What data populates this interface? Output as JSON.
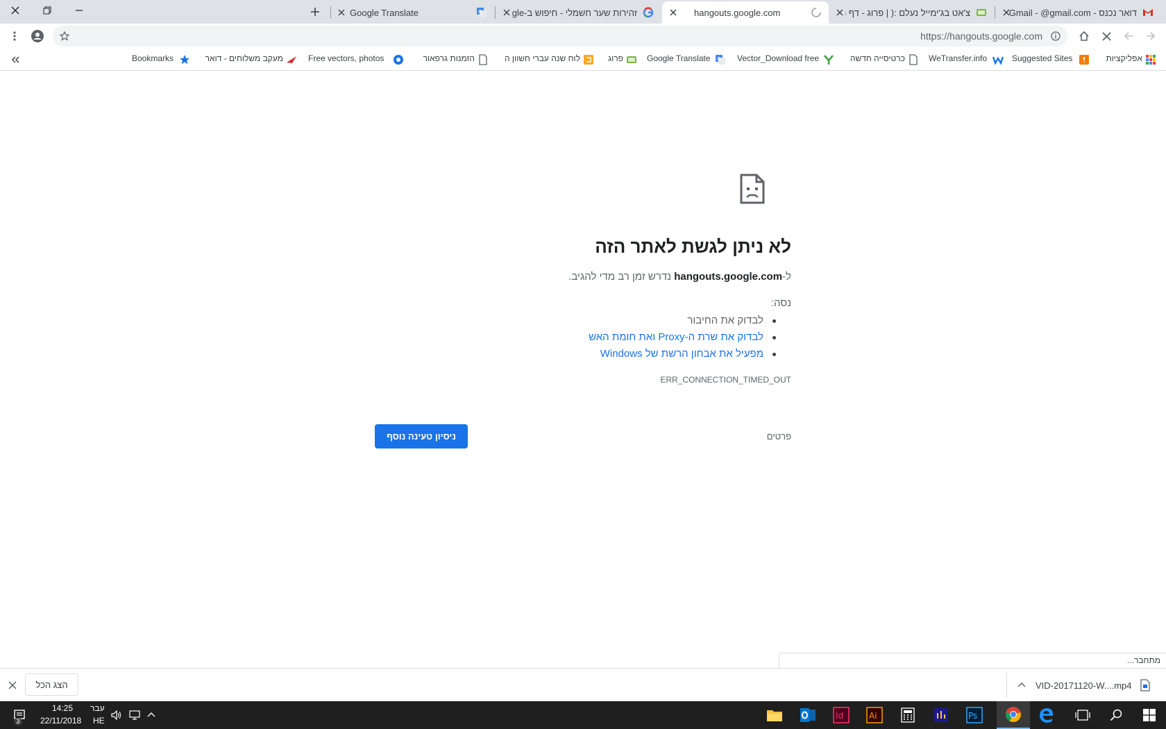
{
  "tabs": [
    {
      "title": "דואר נכנס - Gmail - @gmail.com",
      "active": false
    },
    {
      "title": "צ'אט בג'ימייל נעלם :( | פרוג - דף ה",
      "active": false
    },
    {
      "title": "hangouts.google.com",
      "active": true
    },
    {
      "title": "זהירות שער חשמלי - חיפוש ב-Google",
      "active": false
    },
    {
      "title": "Google Translate",
      "active": false
    }
  ],
  "toolbar": {
    "url": "https://hangouts.google.com"
  },
  "bookmarks": [
    {
      "label": "אפליקציות",
      "icon": "apps-grid-icon"
    },
    {
      "label": "Suggested Sites",
      "icon": "suggested-sites-icon"
    },
    {
      "label": "WeTransfer.info",
      "icon": "wetransfer-icon"
    },
    {
      "label": "כרטיסייה חדשה",
      "icon": "page-icon"
    },
    {
      "label": "Vector_Download free",
      "icon": "yahoo-icon"
    },
    {
      "label": "Google Translate",
      "icon": "translate-icon"
    },
    {
      "label": "פרוג",
      "icon": "prog-icon"
    },
    {
      "label": "לוח שנה עברי חשוון ה",
      "icon": "calendar-icon"
    },
    {
      "label": "הזמנות גרפאור",
      "icon": "page-icon"
    },
    {
      "label": "Free vectors, photos",
      "icon": "freepik-icon"
    },
    {
      "label": "מעקב משלוחים - דואר",
      "icon": "post-icon"
    },
    {
      "label": "Bookmarks",
      "icon": "star-icon"
    }
  ],
  "error": {
    "title": "לא ניתן לגשת לאתר הזה",
    "desc_prefix": "ל-",
    "desc_host": "hangouts.google.com",
    "desc_suffix": " נדרש זמן רב מדי להגיב.",
    "try_label": "נסה:",
    "suggestions": [
      {
        "text": "לבדוק את החיבור",
        "link": false
      },
      {
        "text": "לבדוק את שרת ה-Proxy ואת חומת האש",
        "link": true
      },
      {
        "text": "מפעיל את אבחון הרשת של Windows",
        "link": true
      }
    ],
    "code": "ERR_CONNECTION_TIMED_OUT",
    "details_label": "פרטים",
    "reload_label": "ניסיון טעינה נוסף"
  },
  "status_text": "מתחבר...",
  "download": {
    "filename": "VID-20171120-W....mp4",
    "show_all_label": "הצג הכל"
  },
  "taskbar": {
    "time": "14:25",
    "date": "22/11/2018",
    "lang_top": "עבר",
    "lang_bottom": "HE",
    "notification_count": "3",
    "apps": [
      "file-explorer",
      "outlook",
      "indesign",
      "illustrator",
      "calculator",
      "app",
      "photoshop",
      "chrome",
      "edge",
      "task-view",
      "search",
      "start"
    ]
  },
  "colors": {
    "accent": "#1a73e8",
    "tabstrip": "#dee1e6",
    "taskbar": "#1f1f1f"
  }
}
